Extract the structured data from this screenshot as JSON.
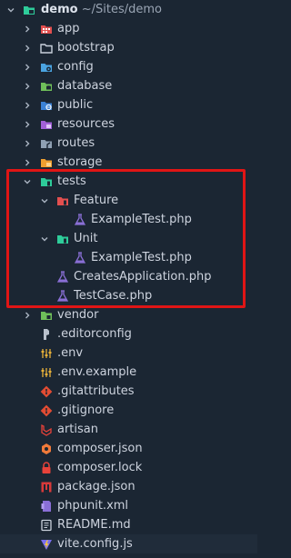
{
  "root": {
    "name": "demo",
    "path": "~/Sites/demo"
  },
  "items": [
    {
      "label": "app",
      "kind": "folder",
      "icon": "app-folder-icon",
      "color": "#e24f4f"
    },
    {
      "label": "bootstrap",
      "kind": "folder",
      "icon": "folder-icon",
      "color": "#c9d1dc"
    },
    {
      "label": "config",
      "kind": "folder",
      "icon": "config-folder-icon",
      "color": "#4aa3e0"
    },
    {
      "label": "database",
      "kind": "folder",
      "icon": "database-folder-icon",
      "color": "#6fbf5a"
    },
    {
      "label": "public",
      "kind": "folder",
      "icon": "public-folder-icon",
      "color": "#3b82d6"
    },
    {
      "label": "resources",
      "kind": "folder",
      "icon": "resources-folder-icon",
      "color": "#a260d8"
    },
    {
      "label": "routes",
      "kind": "folder",
      "icon": "routes-folder-icon",
      "color": "#8fa0b3"
    },
    {
      "label": "storage",
      "kind": "folder",
      "icon": "storage-folder-icon",
      "color": "#f0a030"
    },
    {
      "label": "tests",
      "kind": "folder-open",
      "icon": "tests-folder-icon",
      "color": "#2ecc9a"
    },
    {
      "label": "Feature",
      "kind": "folder-open",
      "icon": "feature-folder-icon",
      "color": "#e24f4f"
    },
    {
      "label": "ExampleTest.php",
      "kind": "file",
      "icon": "php-test-icon",
      "color": "#8a6fd6"
    },
    {
      "label": "Unit",
      "kind": "folder-open",
      "icon": "unit-folder-icon",
      "color": "#2ecc9a"
    },
    {
      "label": "ExampleTest.php",
      "kind": "file",
      "icon": "php-test-icon",
      "color": "#8a6fd6"
    },
    {
      "label": "CreatesApplication.php",
      "kind": "file",
      "icon": "php-test-icon",
      "color": "#8a6fd6"
    },
    {
      "label": "TestCase.php",
      "kind": "file",
      "icon": "php-test-icon",
      "color": "#8a6fd6"
    },
    {
      "label": "vendor",
      "kind": "folder",
      "icon": "vendor-folder-icon",
      "color": "#6fbf5a"
    },
    {
      "label": ".editorconfig",
      "kind": "file",
      "icon": "editorconfig-icon",
      "color": "#b8c0cc"
    },
    {
      "label": ".env",
      "kind": "file",
      "icon": "env-icon",
      "color": "#e8b13a"
    },
    {
      "label": ".env.example",
      "kind": "file",
      "icon": "env-icon",
      "color": "#e8b13a"
    },
    {
      "label": ".gitattributes",
      "kind": "file",
      "icon": "git-icon",
      "color": "#e24c33"
    },
    {
      "label": ".gitignore",
      "kind": "file",
      "icon": "git-icon",
      "color": "#e24c33"
    },
    {
      "label": "artisan",
      "kind": "file",
      "icon": "laravel-icon",
      "color": "#e8423a"
    },
    {
      "label": "composer.json",
      "kind": "file",
      "icon": "composer-icon",
      "color": "#f07a3a"
    },
    {
      "label": "composer.lock",
      "kind": "file",
      "icon": "lock-icon",
      "color": "#e8423a"
    },
    {
      "label": "package.json",
      "kind": "file",
      "icon": "npm-icon",
      "color": "#d83a3a"
    },
    {
      "label": "phpunit.xml",
      "kind": "file",
      "icon": "phpunit-icon",
      "color": "#8a6fd6"
    },
    {
      "label": "README.md",
      "kind": "file",
      "icon": "readme-icon",
      "color": "#c9d1dc"
    },
    {
      "label": "vite.config.js",
      "kind": "file",
      "icon": "vite-icon",
      "color": "#f2c53d"
    }
  ],
  "colors": {
    "background": "#1b2633",
    "highlight": "#e01515",
    "text": "#cdd3de"
  }
}
